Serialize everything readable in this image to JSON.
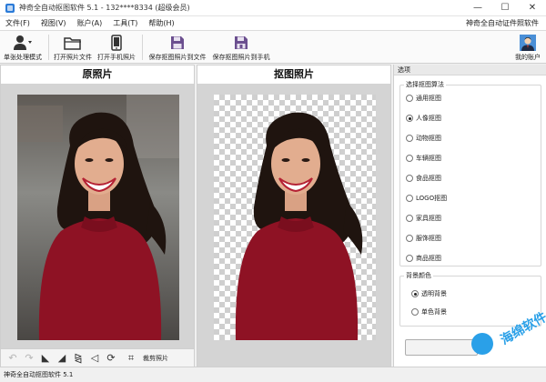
{
  "window": {
    "title": "神奇全自动抠图软件 5.1 - 132****8334 (超级会员)",
    "controls": [
      "—",
      "☐",
      "✕"
    ]
  },
  "menu": {
    "items": [
      "文件(F)",
      "视图(V)",
      "账户(A)",
      "工具(T)",
      "帮助(H)"
    ],
    "right_link": "神奇全自动证件照软件"
  },
  "toolbar": {
    "single_mode": "单张处理模式",
    "open_file": "打开照片文件",
    "open_phone": "打开手机照片",
    "save_file": "保存抠图照片到文件",
    "save_phone": "保存抠图照片到手机",
    "my_account": "我的账户"
  },
  "panels": {
    "original_title": "原照片",
    "result_title": "抠图照片"
  },
  "left_tools": {
    "crop_label": "裁剪照片"
  },
  "options": {
    "header": "选项",
    "algorithm_group": "选择抠图算法",
    "algorithms": [
      "通用抠图",
      "人像抠图",
      "动物抠图",
      "车辆抠图",
      "食品抠图",
      "LOGO抠图",
      "家具抠图",
      "服饰抠图",
      "商品抠图"
    ],
    "selected_algorithm": "人像抠图",
    "background_group": "背景颜色",
    "backgrounds": [
      "透明背景",
      "单色背景"
    ],
    "selected_background": "透明背景"
  },
  "watermark": {
    "text": "海绵软件"
  },
  "status": {
    "text": "神奇全自动抠图软件 5.1"
  },
  "colors": {
    "accent": "#2b7bd8",
    "dress": "#8e1224",
    "watermark": "#2aa0e8"
  }
}
